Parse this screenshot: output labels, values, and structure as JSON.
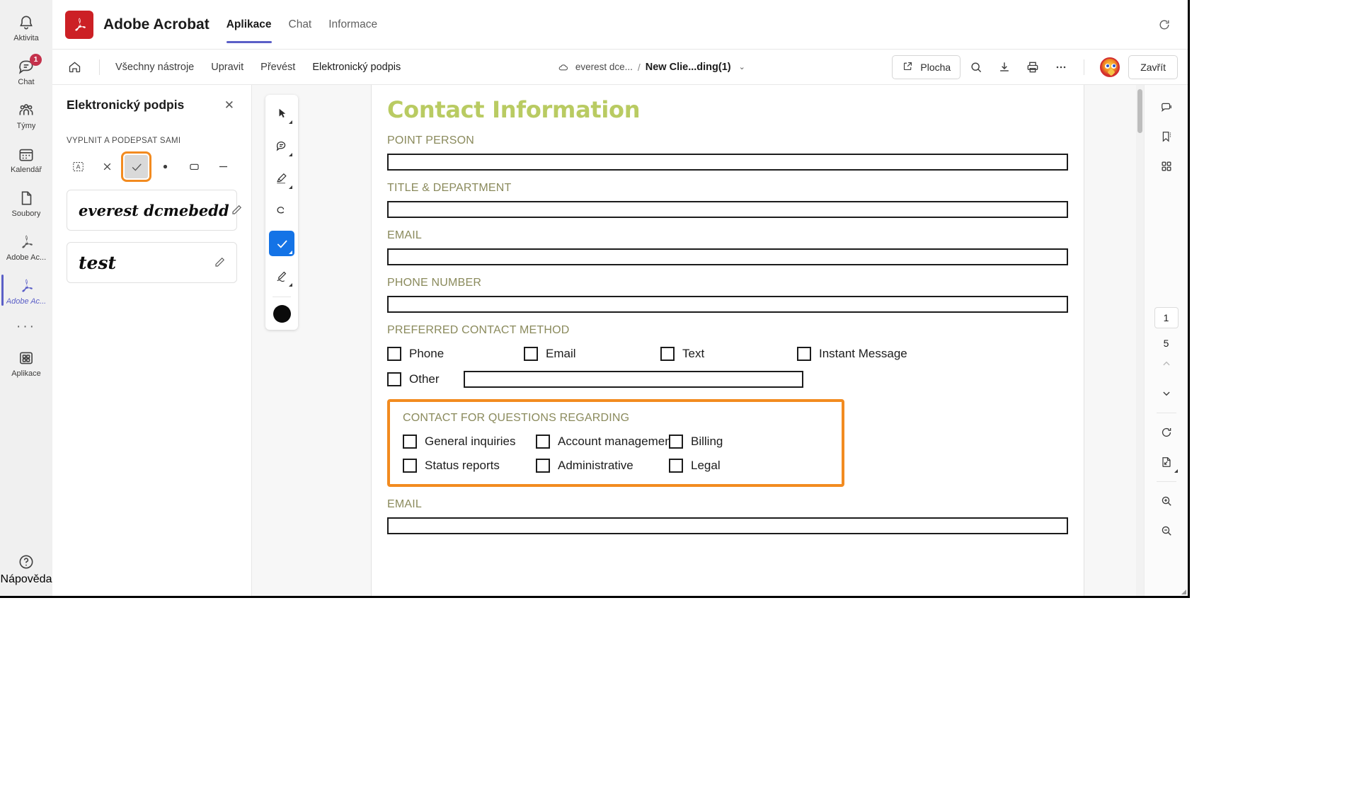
{
  "rail": {
    "items": [
      {
        "label": "Aktivita",
        "icon": "bell-icon",
        "badge": null,
        "active": false
      },
      {
        "label": "Chat",
        "icon": "chat-icon",
        "badge": "1",
        "active": false
      },
      {
        "label": "Týmy",
        "icon": "teams-icon",
        "badge": null,
        "active": false
      },
      {
        "label": "Kalendář",
        "icon": "calendar-icon",
        "badge": null,
        "active": false
      },
      {
        "label": "Soubory",
        "icon": "file-icon",
        "badge": null,
        "active": false
      },
      {
        "label": "Adobe Ac...",
        "icon": "adobe-acrobat-icon",
        "badge": null,
        "active": false
      },
      {
        "label": "Adobe Ac...",
        "icon": "adobe-acrobat-icon",
        "badge": null,
        "active": true
      }
    ],
    "more_label": "···",
    "apps": {
      "label": "Aplikace",
      "icon": "apps-grid-icon"
    },
    "help": {
      "label": "Nápověda",
      "icon": "help-circle-icon"
    }
  },
  "header": {
    "app_title": "Adobe Acrobat",
    "tabs": [
      {
        "label": "Aplikace",
        "active": true
      },
      {
        "label": "Chat",
        "active": false
      },
      {
        "label": "Informace",
        "active": false
      }
    ],
    "refresh_icon": "refresh-icon"
  },
  "toolbar": {
    "home_icon": "home-icon",
    "menu": [
      {
        "label": "Všechny nástroje",
        "active": false
      },
      {
        "label": "Upravit",
        "active": false
      },
      {
        "label": "Převést",
        "active": false
      },
      {
        "label": "Elektronický podpis",
        "active": true
      }
    ],
    "breadcrumb": {
      "cloud_icon": "cloud-icon",
      "folder": "everest dce...",
      "separator": "/",
      "file": "New Clie...ding(1)",
      "caret": "⌄"
    },
    "desktop_button": {
      "label": "Plocha",
      "icon": "open-external-icon"
    },
    "icons": [
      {
        "name": "search-icon"
      },
      {
        "name": "download-icon"
      },
      {
        "name": "print-icon"
      },
      {
        "name": "more-options-icon"
      }
    ],
    "avatar": "user-avatar",
    "close_button": "Zavřít"
  },
  "sign_panel": {
    "title": "Elektronický podpis",
    "close_icon": "close-icon",
    "section_label": "VYPLNIT A PODEPSAT SAMI",
    "tools": [
      {
        "name": "add-text-icon",
        "selected": false,
        "highlighted": false
      },
      {
        "name": "cross-mark-icon",
        "selected": false,
        "highlighted": false
      },
      {
        "name": "check-mark-icon",
        "selected": true,
        "highlighted": true
      },
      {
        "name": "dot-icon",
        "selected": false,
        "highlighted": false
      },
      {
        "name": "rectangle-icon",
        "selected": false,
        "highlighted": false
      },
      {
        "name": "line-icon",
        "selected": false,
        "highlighted": false
      }
    ],
    "signatures": [
      {
        "text": "everest dcmebedd",
        "edit_icon": "pencil-icon"
      },
      {
        "text": "test",
        "edit_icon": "pencil-icon"
      }
    ]
  },
  "vertical_tools": [
    {
      "name": "select-cursor-icon",
      "active": false,
      "has_caret": true
    },
    {
      "name": "comment-icon",
      "active": false,
      "has_caret": true
    },
    {
      "name": "highlighter-icon",
      "active": false,
      "has_caret": true
    },
    {
      "name": "eraser-icon",
      "active": false,
      "has_caret": false
    },
    {
      "name": "check-mark-icon",
      "active": true,
      "has_caret": true
    },
    {
      "name": "signature-pen-icon",
      "active": false,
      "has_caret": true
    },
    {
      "name": "color-swatch-black",
      "active": false,
      "has_caret": false
    }
  ],
  "document": {
    "title": "Contact Information",
    "title_color": "#b9cb62",
    "fields": [
      {
        "label": "POINT PERSON",
        "value": ""
      },
      {
        "label": "TITLE & DEPARTMENT",
        "value": ""
      },
      {
        "label": "EMAIL",
        "value": ""
      },
      {
        "label": "PHONE NUMBER",
        "value": ""
      }
    ],
    "preferred_contact": {
      "label": "PREFERRED CONTACT METHOD",
      "options": [
        "Phone",
        "Email",
        "Text",
        "Instant Message"
      ],
      "other_label": "Other",
      "other_value": ""
    },
    "questions_section": {
      "label": "CONTACT FOR QUESTIONS REGARDING",
      "highlight_color": "#f28b20",
      "row1": [
        "General inquiries",
        "Account management",
        "Billing"
      ],
      "row2": [
        "Status reports",
        "Administrative",
        "Legal"
      ]
    },
    "bottom_field": {
      "label": "EMAIL",
      "value": ""
    }
  },
  "right_rail": {
    "top_icons": [
      {
        "name": "comments-panel-icon"
      },
      {
        "name": "bookmarks-icon"
      },
      {
        "name": "page-thumbnails-icon"
      }
    ],
    "current_page": "1",
    "total_pages": "5",
    "prev_icon": "chevron-up-icon",
    "next_icon": "chevron-down-icon",
    "bottom_icons": [
      {
        "name": "rotate-icon"
      },
      {
        "name": "fit-page-icon"
      },
      {
        "name": "zoom-in-icon"
      },
      {
        "name": "zoom-out-icon"
      }
    ]
  }
}
